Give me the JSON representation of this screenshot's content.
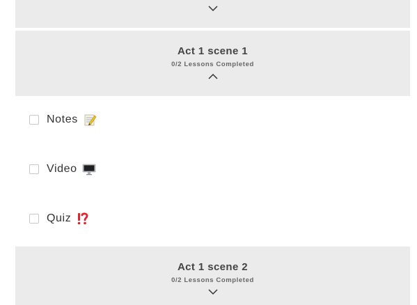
{
  "sections": {
    "top": {
      "expanded": false
    },
    "scene1": {
      "title": "Act 1 scene 1",
      "progress": "0/2 Lessons Completed",
      "expanded": true
    },
    "scene2": {
      "title": "Act 1 scene 2",
      "progress": "0/2 Lessons Completed",
      "expanded": false
    }
  },
  "lessons": [
    {
      "label": "Notes",
      "icon": "memo-icon",
      "checked": false
    },
    {
      "label": "Video",
      "icon": "desktop-computer-icon",
      "checked": false
    },
    {
      "label": "Quiz",
      "icon": "interrobang-icon",
      "checked": false
    }
  ],
  "colors": {
    "header_bg": "#ebebeb",
    "text": "#333333",
    "accent_red": "#e0242c"
  }
}
